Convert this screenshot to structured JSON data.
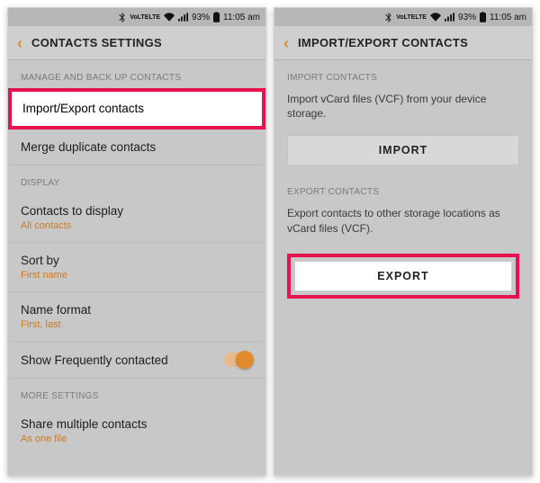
{
  "status": {
    "lte_top": "VoLTE",
    "lte_bottom": "LTE",
    "battery_pct": "93%",
    "time": "11:05 am"
  },
  "left": {
    "header": "CONTACTS SETTINGS",
    "sections": {
      "manage": "MANAGE AND BACK UP CONTACTS",
      "display": "DISPLAY",
      "more": "MORE SETTINGS"
    },
    "rows": {
      "import_export": "Import/Export contacts",
      "merge": "Merge duplicate contacts",
      "contacts_display": "Contacts to display",
      "contacts_display_sub": "All contacts",
      "sort_by": "Sort by",
      "sort_by_sub": "First name",
      "name_format": "Name format",
      "name_format_sub": "First, last",
      "freq": "Show Frequently contacted",
      "share_multi": "Share multiple contacts",
      "share_multi_sub": "As one file"
    }
  },
  "right": {
    "header": "IMPORT/EXPORT CONTACTS",
    "import_label": "IMPORT CONTACTS",
    "import_desc": "Import vCard files (VCF) from your device storage.",
    "import_btn": "IMPORT",
    "export_label": "EXPORT CONTACTS",
    "export_desc": "Export contacts to other storage locations as vCard files (VCF).",
    "export_btn": "EXPORT"
  }
}
